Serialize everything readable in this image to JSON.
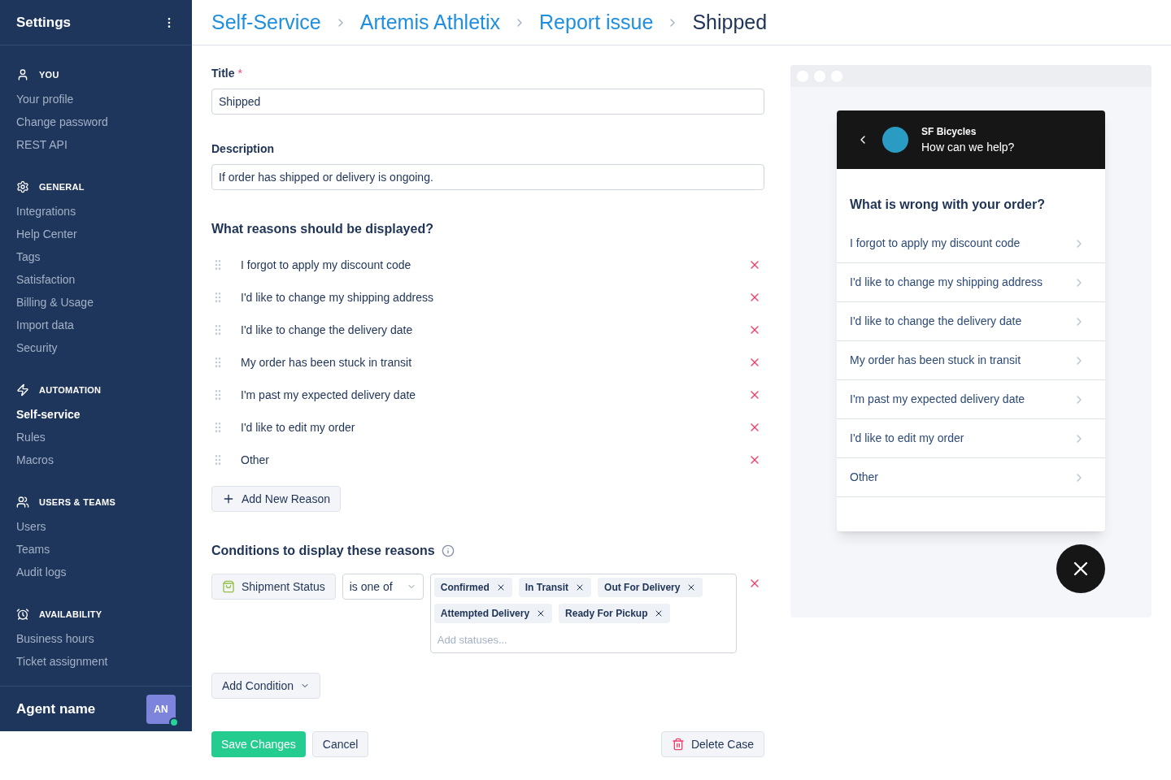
{
  "sidebar": {
    "title": "Settings",
    "sections": [
      {
        "kind": "user",
        "title": "YOU",
        "items": [
          {
            "label": "Your profile",
            "selected": false
          },
          {
            "label": "Change password",
            "selected": false
          },
          {
            "label": "REST API",
            "selected": false
          }
        ]
      },
      {
        "kind": "gear",
        "title": "GENERAL",
        "items": [
          {
            "label": "Integrations",
            "selected": false
          },
          {
            "label": "Help Center",
            "selected": false
          },
          {
            "label": "Tags",
            "selected": false
          },
          {
            "label": "Satisfaction",
            "selected": false
          },
          {
            "label": "Billing & Usage",
            "selected": false
          },
          {
            "label": "Import data",
            "selected": false
          },
          {
            "label": "Security",
            "selected": false
          }
        ]
      },
      {
        "kind": "bolt",
        "title": "AUTOMATION",
        "items": [
          {
            "label": "Self-service",
            "selected": true
          },
          {
            "label": "Rules",
            "selected": false
          },
          {
            "label": "Macros",
            "selected": false
          }
        ]
      },
      {
        "kind": "users",
        "title": "USERS & TEAMS",
        "items": [
          {
            "label": "Users",
            "selected": false
          },
          {
            "label": "Teams",
            "selected": false
          },
          {
            "label": "Audit logs",
            "selected": false
          }
        ]
      },
      {
        "kind": "clock",
        "title": "AVAILABILITY",
        "items": [
          {
            "label": "Business hours",
            "selected": false
          },
          {
            "label": "Ticket assignment",
            "selected": false
          }
        ]
      }
    ],
    "agent": {
      "name": "Agent name",
      "initials": "AN"
    }
  },
  "breadcrumbs": [
    "Self-Service",
    "Artemis Athletix",
    "Report issue",
    "Shipped"
  ],
  "form": {
    "title_label": "Title",
    "required_mark": "*",
    "title_value": "Shipped",
    "description_label": "Description",
    "description_value": "If order has shipped or delivery is ongoing.",
    "reasons_heading": "What reasons should be displayed?",
    "reasons": [
      "I forgot to apply my discount code",
      "I'd like to change my shipping address",
      "I'd like to change the delivery date",
      "My order has been stuck in transit",
      "I'm past my expected delivery date",
      "I'd like to edit my order",
      "Other"
    ],
    "add_reason": "Add New Reason",
    "conditions_heading": "Conditions to display these reasons",
    "condition": {
      "field": "Shipment Status",
      "operator": "is one of",
      "tags": [
        "Confirmed",
        "In Transit",
        "Out For Delivery",
        "Attempted Delivery",
        "Ready For Pickup"
      ],
      "placeholder": "Add statuses..."
    },
    "add_condition": "Add Condition",
    "save": "Save Changes",
    "cancel": "Cancel",
    "delete": "Delete Case"
  },
  "preview": {
    "brand": "SF Bicycles",
    "subtitle": "How can we help?",
    "question": "What is wrong with your order?",
    "options": [
      "I forgot to apply my discount code",
      "I'd like to change my shipping address",
      "I'd like to change the delivery date",
      "My order has been stuck in transit",
      "I'm past my expected delivery date",
      "I'd like to edit my order",
      "Other"
    ]
  }
}
